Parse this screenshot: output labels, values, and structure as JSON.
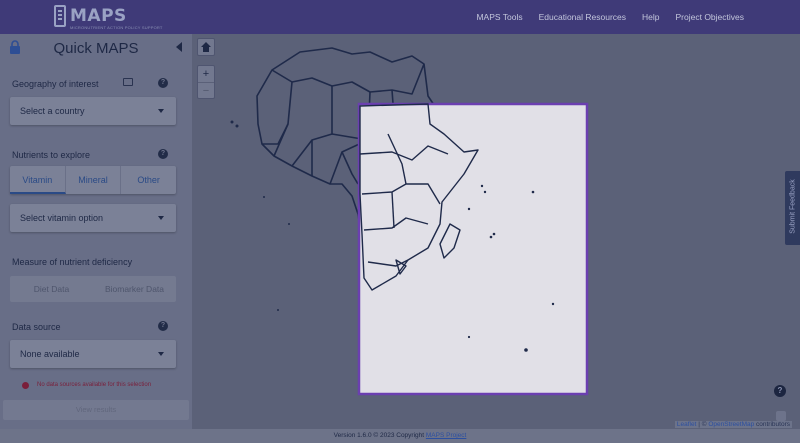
{
  "header": {
    "logo_text": "MAPS",
    "logo_subtitle": "MICRONUTRIENT ACTION POLICY SUPPORT",
    "nav": [
      "MAPS Tools",
      "Educational Resources",
      "Help",
      "Project Objectives"
    ]
  },
  "sidebar": {
    "title": "Quick MAPS",
    "geography": {
      "label": "Geography of interest",
      "select_value": "Select a country"
    },
    "nutrients": {
      "label": "Nutrients to explore",
      "tabs": [
        "Vitamin",
        "Mineral",
        "Other"
      ],
      "active_tab": "Vitamin",
      "select_value": "Select vitamin option"
    },
    "measure": {
      "label": "Measure of nutrient deficiency",
      "options": [
        "Diet Data",
        "Biomarker Data"
      ]
    },
    "data_source": {
      "label": "Data source",
      "select_value": "None available",
      "error": "No data sources available for this selection"
    },
    "view_results_label": "View results"
  },
  "map": {
    "zoom_in": "+",
    "zoom_out": "−",
    "feedback_label": "Submit Feedback",
    "help_label": "?",
    "attribution": {
      "leaflet": "Leaflet",
      "separator": " | © ",
      "osm": "OpenStreetMap",
      "contributors": " contributors"
    },
    "highlight_color": "#6b3fb0"
  },
  "footer": {
    "text": "Version 1.6.0 © 2023 Copyright ",
    "link": "MAPS Project"
  }
}
